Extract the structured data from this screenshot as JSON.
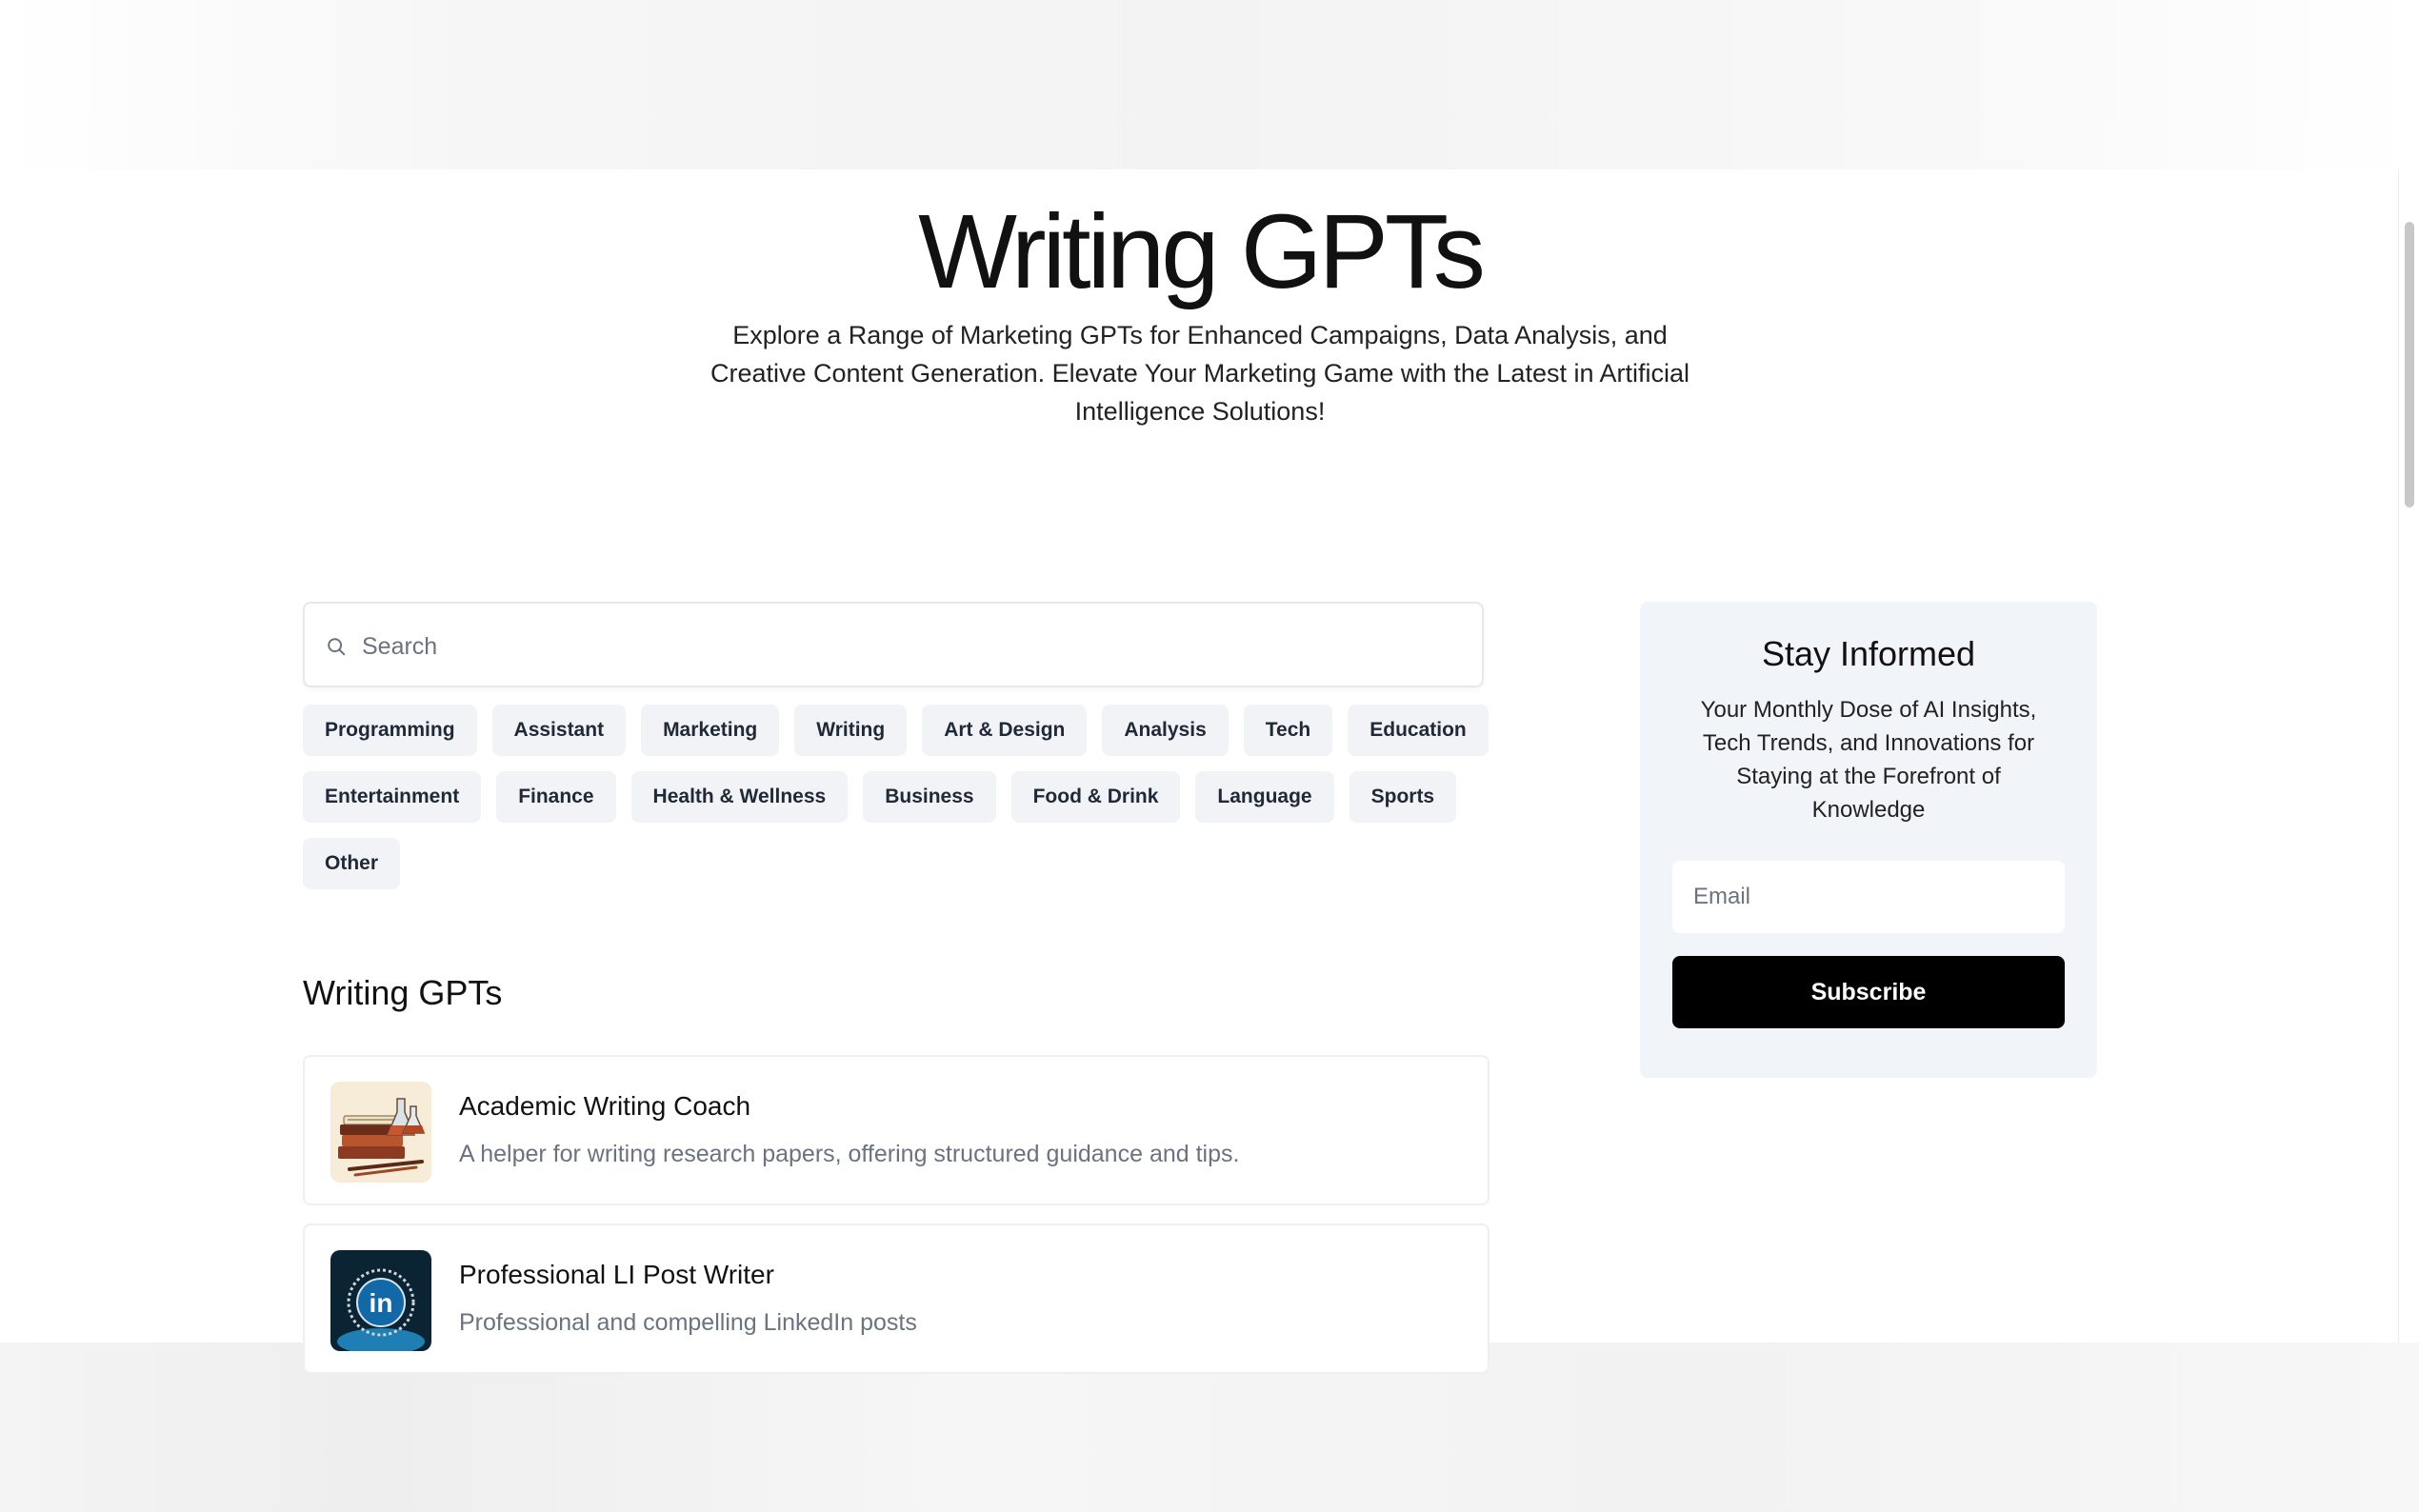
{
  "hero": {
    "title": "Writing GPTs",
    "subtitle": "Explore a Range of Marketing GPTs for Enhanced Campaigns, Data Analysis, and Creative Content Generation. Elevate Your Marketing Game with the Latest in Artificial Intelligence Solutions!"
  },
  "search": {
    "placeholder": "Search",
    "value": ""
  },
  "categories": [
    "Programming",
    "Assistant",
    "Marketing",
    "Writing",
    "Art & Design",
    "Analysis",
    "Tech",
    "Education",
    "Entertainment",
    "Finance",
    "Health & Wellness",
    "Business",
    "Food & Drink",
    "Language",
    "Sports",
    "Other"
  ],
  "section": {
    "title": "Writing GPTs"
  },
  "gpts": [
    {
      "name": "Academic Writing Coach",
      "description": "A helper for writing research papers, offering structured guidance and tips.",
      "icon": "books-and-flasks-icon"
    },
    {
      "name": "Professional LI Post Writer",
      "description": "Professional and compelling LinkedIn posts",
      "icon": "linkedin-badge-icon"
    }
  ],
  "newsletter": {
    "title": "Stay Informed",
    "text": "Your Monthly Dose of AI Insights, Tech Trends, and Innovations for Staying at the Forefront of Knowledge",
    "email_placeholder": "Email",
    "email_value": "",
    "button_label": "Subscribe"
  },
  "colors": {
    "background": "#ffffff",
    "chip_background": "#f1f3f6",
    "panel_background": "#f1f4f8",
    "button": "#000000",
    "muted_text": "#6b7280"
  }
}
